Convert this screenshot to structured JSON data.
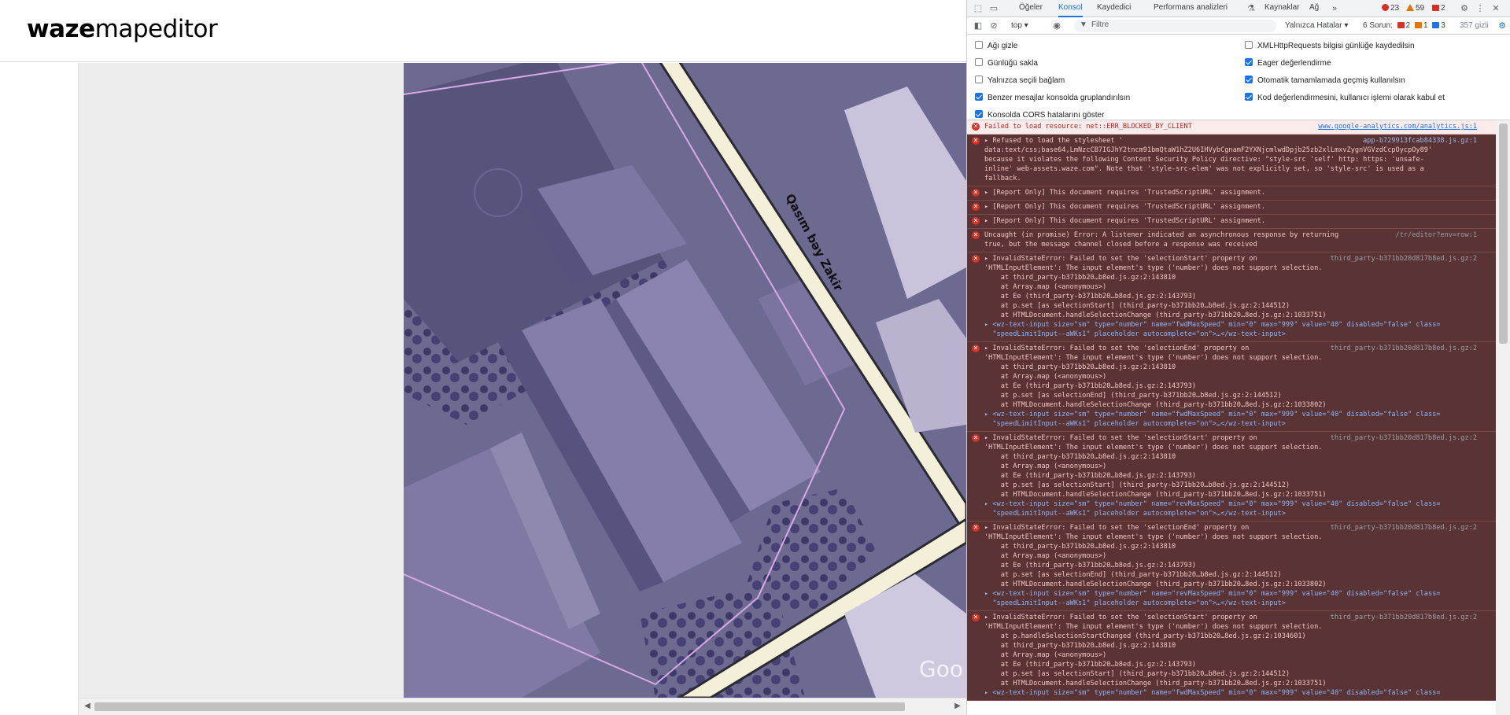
{
  "waze": {
    "logo_bold": "waze",
    "logo_regular": "mapeditor",
    "street_label": "Qasım bəy Zakir",
    "watermark": "Goo"
  },
  "devtools": {
    "tabs": [
      "Öğeler",
      "Konsol",
      "Kaydedici",
      "Performans analizleri",
      "Kaynaklar",
      "Ağ"
    ],
    "active_tab": "Konsol",
    "errors_count": "23",
    "warnings_count": "59",
    "issues_count": "2",
    "toolbar": {
      "context": "top",
      "filter_placeholder": "Filtre",
      "level": "Yalnızca Hatalar",
      "issues_label": "6 Sorun:",
      "issues_red": "2",
      "issues_yellow": "1",
      "issues_blue": "3",
      "hidden": "357 gizli"
    },
    "settings_left": [
      {
        "label": "Ağı gizle",
        "checked": false
      },
      {
        "label": "Günlüğü sakla",
        "checked": false
      },
      {
        "label": "Yalnızca seçili bağlam",
        "checked": false
      },
      {
        "label": "Benzer mesajlar konsolda gruplandırılsın",
        "checked": true
      },
      {
        "label": "Konsolda CORS hatalarını göster",
        "checked": true
      }
    ],
    "settings_right": [
      {
        "label": "XMLHttpRequests bilgisi günlüğe kaydedilsin",
        "checked": false
      },
      {
        "label": "Eager değerlendirme",
        "checked": true
      },
      {
        "label": "Otomatik tamamlamada geçmiş kullanılsın",
        "checked": true
      },
      {
        "label": "Kod değerlendirmesini, kullanıcı işlemi olarak kabul et",
        "checked": true
      }
    ],
    "messages": [
      {
        "style": "light",
        "source": "www.google-analytics.com/analytics.js:1",
        "lines": [
          "Failed to load resource: net::ERR_BLOCKED_BY_CLIENT"
        ]
      },
      {
        "style": "dark",
        "source": "app-b729913fcab84338.js.gz:1",
        "lines": [
          "▸ Refused to load the stylesheet '",
          "data:text/css;base64,LmNzcCB7IGJhY2tncm91bmQtaW1hZ2U6IHVybCgnamF2YXNjcmlwdDpjb25zb2xlLmxvZygnVGVzdCcpOycpOy89'",
          "because it violates the following Content Security Policy directive: \"style-src 'self' http: https: 'unsafe-",
          "inline' web-assets.waze.com\". Note that 'style-src-elem' was not explicitly set, so 'style-src' is used as a",
          "fallback."
        ]
      },
      {
        "style": "dark",
        "source": "",
        "lines": [
          "▸ [Report Only] This document requires 'TrustedScriptURL' assignment."
        ]
      },
      {
        "style": "dark",
        "source": "",
        "lines": [
          "▸ [Report Only] This document requires 'TrustedScriptURL' assignment."
        ]
      },
      {
        "style": "dark",
        "source": "",
        "lines": [
          "▸ [Report Only] This document requires 'TrustedScriptURL' assignment."
        ]
      },
      {
        "style": "dark",
        "source": "/tr/editor?env=row:1",
        "lines": [
          "Uncaught (in promise) Error: A listener indicated an asynchronous response by returning",
          "true, but the message channel closed before a response was received"
        ]
      },
      {
        "style": "dark",
        "source": "third_party-b371bb20d817b8ed.js.gz:2",
        "lines": [
          "▸ InvalidStateError: Failed to set the 'selectionStart' property on",
          "'HTMLInputElement': The input element's type ('number') does not support selection.",
          "    at third_party-b371bb20…b8ed.js.gz:2:143810",
          "    at Array.map (<anonymous>)",
          "    at Ee (third_party-b371bb20…b8ed.js.gz:2:143793)",
          "    at p.set [as selectionStart] (third_party-b371bb20…b8ed.js.gz:2:144512)",
          "    at HTMLDocument.handleSelectionChange (third_party-b371bb20…8ed.js.gz:2:1033751)",
          "▸ <wz-text-input size=\"sm\" type=\"number\" name=\"fwdMaxSpeed\" min=\"0\" max=\"999\" value=\"40\" disabled=\"false\" class=",
          "  \"speedLimitInput--aWKs1\" placeholder autocomplete=\"on\">…</wz-text-input>"
        ]
      },
      {
        "style": "dark",
        "source": "third_party-b371bb20d817b8ed.js.gz:2",
        "lines": [
          "▸ InvalidStateError: Failed to set the 'selectionEnd' property on",
          "'HTMLInputElement': The input element's type ('number') does not support selection.",
          "    at third_party-b371bb20…b8ed.js.gz:2:143810",
          "    at Array.map (<anonymous>)",
          "    at Ee (third_party-b371bb20…b8ed.js.gz:2:143793)",
          "    at p.set [as selectionEnd] (third_party-b371bb20…b8ed.js.gz:2:144512)",
          "    at HTMLDocument.handleSelectionChange (third_party-b371bb20…8ed.js.gz:2:1033802)",
          "▸ <wz-text-input size=\"sm\" type=\"number\" name=\"fwdMaxSpeed\" min=\"0\" max=\"999\" value=\"40\" disabled=\"false\" class=",
          "  \"speedLimitInput--aWKs1\" placeholder autocomplete=\"on\">…</wz-text-input>"
        ]
      },
      {
        "style": "dark",
        "source": "third_party-b371bb20d817b8ed.js.gz:2",
        "lines": [
          "▸ InvalidStateError: Failed to set the 'selectionStart' property on",
          "'HTMLInputElement': The input element's type ('number') does not support selection.",
          "    at third_party-b371bb20…b8ed.js.gz:2:143810",
          "    at Array.map (<anonymous>)",
          "    at Ee (third_party-b371bb20…b8ed.js.gz:2:143793)",
          "    at p.set [as selectionStart] (third_party-b371bb20…b8ed.js.gz:2:144512)",
          "    at HTMLDocument.handleSelectionChange (third_party-b371bb20…8ed.js.gz:2:1033751)",
          "▸ <wz-text-input size=\"sm\" type=\"number\" name=\"revMaxSpeed\" min=\"0\" max=\"999\" value=\"40\" disabled=\"false\" class=",
          "  \"speedLimitInput--aWKs1\" placeholder autocomplete=\"on\">…</wz-text-input>"
        ]
      },
      {
        "style": "dark",
        "source": "third_party-b371bb20d817b8ed.js.gz:2",
        "lines": [
          "▸ InvalidStateError: Failed to set the 'selectionEnd' property on",
          "'HTMLInputElement': The input element's type ('number') does not support selection.",
          "    at third_party-b371bb20…b8ed.js.gz:2:143810",
          "    at Array.map (<anonymous>)",
          "    at Ee (third_party-b371bb20…b8ed.js.gz:2:143793)",
          "    at p.set [as selectionEnd] (third_party-b371bb20…b8ed.js.gz:2:144512)",
          "    at HTMLDocument.handleSelectionChange (third_party-b371bb20…8ed.js.gz:2:1033802)",
          "▸ <wz-text-input size=\"sm\" type=\"number\" name=\"revMaxSpeed\" min=\"0\" max=\"999\" value=\"40\" disabled=\"false\" class=",
          "  \"speedLimitInput--aWKs1\" placeholder autocomplete=\"on\">…</wz-text-input>"
        ]
      },
      {
        "style": "dark",
        "source": "third_party-b371bb20d817b8ed.js.gz:2",
        "lines": [
          "▸ InvalidStateError: Failed to set the 'selectionStart' property on",
          "'HTMLInputElement': The input element's type ('number') does not support selection.",
          "    at p.handleSelectionStartChanged (third_party-b371bb20…8ed.js.gz:2:1034601)",
          "    at third_party-b371bb20…b8ed.js.gz:2:143810",
          "    at Array.map (<anonymous>)",
          "    at Ee (third_party-b371bb20…b8ed.js.gz:2:143793)",
          "    at p.set [as selectionStart] (third_party-b371bb20…b8ed.js.gz:2:144512)",
          "    at HTMLDocument.handleSelectionChange (third_party-b371bb20…8ed.js.gz:2:1033751)",
          "▸ <wz-text-input size=\"sm\" type=\"number\" name=\"fwdMaxSpeed\" min=\"0\" max=\"999\" value=\"40\" disabled=\"false\" class="
        ]
      }
    ]
  }
}
